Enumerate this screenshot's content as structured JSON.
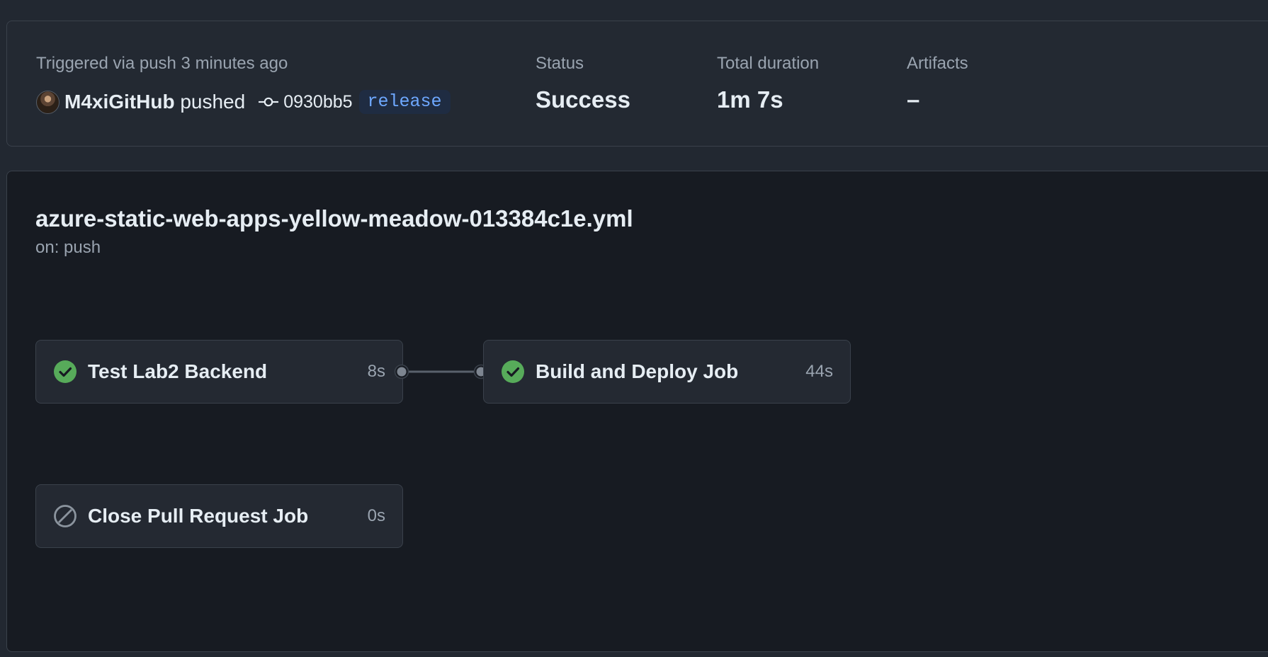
{
  "summary": {
    "trigger_text": "Triggered via push 3 minutes ago",
    "actor": "M4xiGitHub",
    "action": "pushed",
    "commit_sha": "0930bb5",
    "branch": "release",
    "status_label": "Status",
    "status_value": "Success",
    "duration_label": "Total duration",
    "duration_value": "1m 7s",
    "artifacts_label": "Artifacts",
    "artifacts_value": "–"
  },
  "workflow": {
    "file_name": "azure-static-web-apps-yellow-meadow-013384c1e.yml",
    "trigger": "on: push"
  },
  "jobs": [
    {
      "name": "Test Lab2 Backend",
      "duration": "8s",
      "status": "success",
      "icon": "check-circle-icon"
    },
    {
      "name": "Build and Deploy Job",
      "duration": "44s",
      "status": "success",
      "icon": "check-circle-icon"
    },
    {
      "name": "Close Pull Request Job",
      "duration": "0s",
      "status": "skipped",
      "icon": "skipped-icon"
    }
  ],
  "colors": {
    "success": "#57ab5a",
    "skipped": "#8b949e",
    "branch_text": "#6ea8ff",
    "branch_bg": "#1f2c42"
  }
}
